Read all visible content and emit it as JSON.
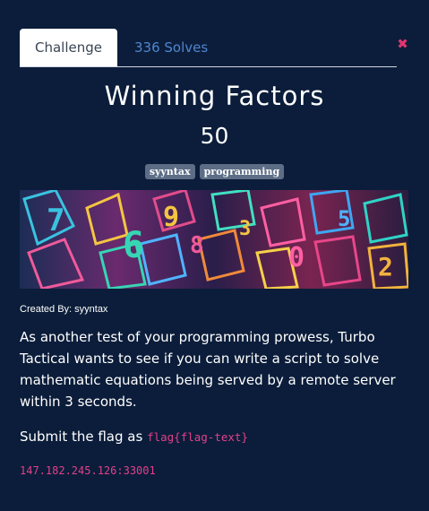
{
  "tabs": {
    "challenge": "Challenge",
    "solves": "336 Solves"
  },
  "close_glyph": "✖",
  "challenge": {
    "title": "Winning Factors",
    "points": "50",
    "tags": [
      "syyntax",
      "programming"
    ],
    "created_by": "Created By: syyntax",
    "description": "As another test of your programming prowess, Turbo Tactical wants to see if you can write a script to solve mathematic equations being served by a remote server within 3 seconds.",
    "submit_prefix": "Submit the flag as ",
    "flag_format": "flag{flag-text}",
    "address": "147.182.245.126:33001"
  },
  "colors": {
    "background": "#0b1d3a",
    "accent_pink": "#e3408a",
    "link_blue": "#4f86d0",
    "tag_bg": "#5d6d86"
  },
  "banner": {
    "type": "image",
    "icon": "colorful-numbers-artwork"
  }
}
